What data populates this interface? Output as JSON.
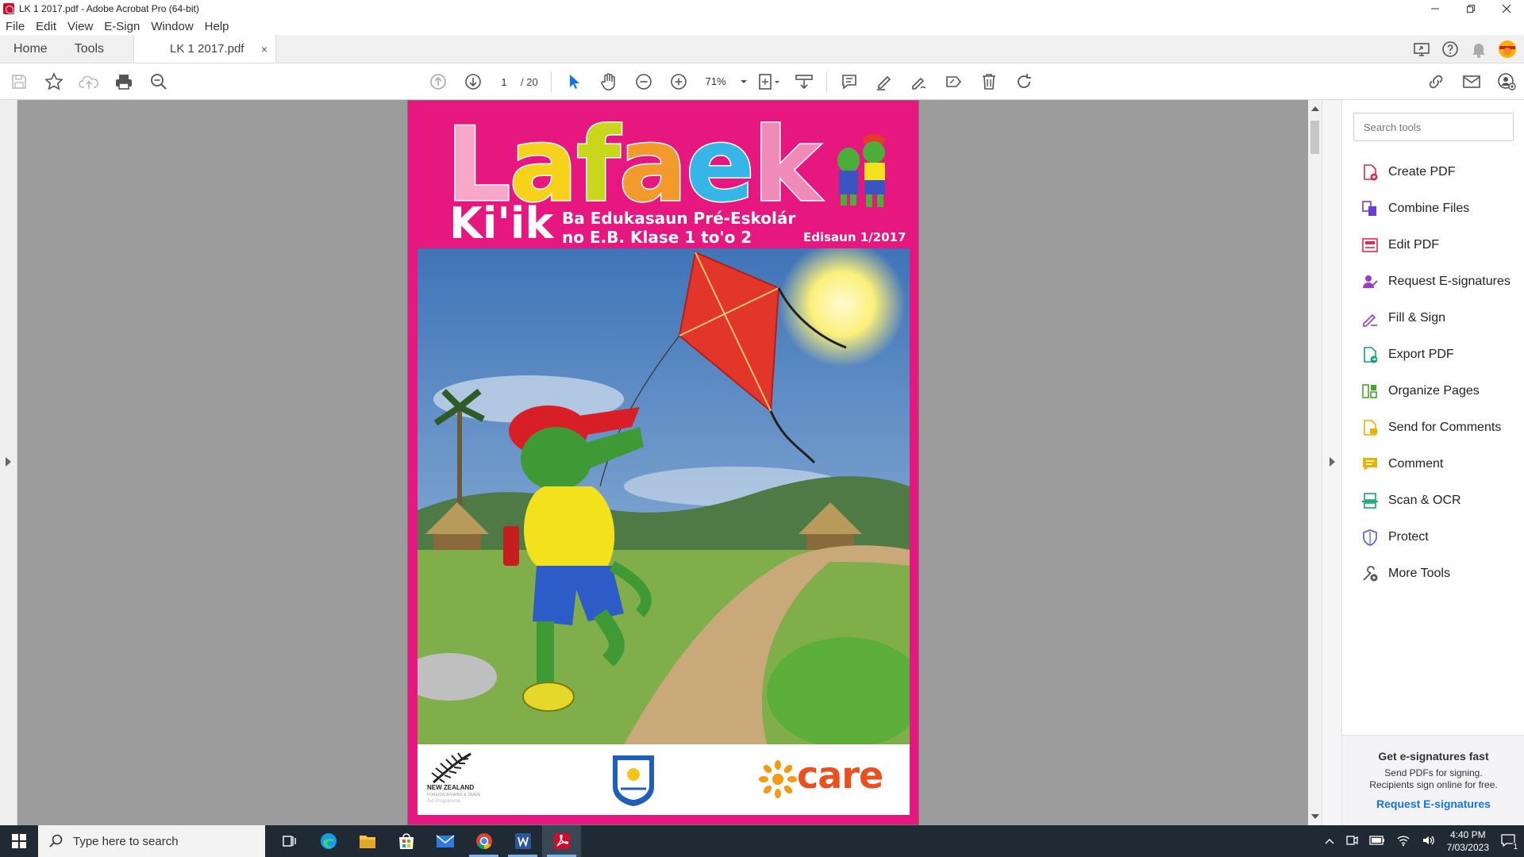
{
  "window": {
    "title": "LK 1 2017.pdf - Adobe Acrobat Pro (64-bit)"
  },
  "menu": [
    "File",
    "Edit",
    "View",
    "E-Sign",
    "Window",
    "Help"
  ],
  "tabs": {
    "home": "Home",
    "tools": "Tools",
    "document": "LK 1 2017.pdf",
    "close_glyph": "×"
  },
  "toolbar": {
    "page_current": "1",
    "page_total": "/ 20",
    "zoom": "71%"
  },
  "document": {
    "title_letters": [
      {
        "ch": "L",
        "color": "#f7a7c8"
      },
      {
        "ch": "a",
        "color": "#f6d21a"
      },
      {
        "ch": "f",
        "color": "#c8d61c"
      },
      {
        "ch": "a",
        "color": "#f39a2c"
      },
      {
        "ch": "e",
        "color": "#35b6e6"
      },
      {
        "ch": "k",
        "color": "#f08ab8"
      }
    ],
    "subtitle": "Ki'ik",
    "tagline_1": "Ba Edukasaun Pré-Eskolár",
    "tagline_2": "no E.B. Klase 1 to'o 2",
    "edition": "Edisaun 1/2017",
    "nz_logo_1": "NEW ZEALAND",
    "nz_logo_2": "FOREIGN AFFAIRS & TRADE",
    "nz_logo_3": "Aid Programme",
    "care_logo": "care"
  },
  "tools_panel": {
    "search_placeholder": "Search tools",
    "items": [
      {
        "label": "Create PDF",
        "icon": "create-pdf-icon",
        "color": "#e0294b"
      },
      {
        "label": "Combine Files",
        "icon": "combine-files-icon",
        "color": "#6b3ccf"
      },
      {
        "label": "Edit PDF",
        "icon": "edit-pdf-icon",
        "color": "#e0294b"
      },
      {
        "label": "Request E-signatures",
        "icon": "request-esign-icon",
        "color": "#9b3cc6"
      },
      {
        "label": "Fill & Sign",
        "icon": "fill-sign-icon",
        "color": "#9b3cc6"
      },
      {
        "label": "Export PDF",
        "icon": "export-pdf-icon",
        "color": "#1aa07a"
      },
      {
        "label": "Organize Pages",
        "icon": "organize-pages-icon",
        "color": "#4aa22e"
      },
      {
        "label": "Send for Comments",
        "icon": "send-comments-icon",
        "color": "#e8b400"
      },
      {
        "label": "Comment",
        "icon": "comment-icon",
        "color": "#e8b400"
      },
      {
        "label": "Scan & OCR",
        "icon": "scan-ocr-icon",
        "color": "#1aa07a"
      },
      {
        "label": "Protect",
        "icon": "protect-icon",
        "color": "#4b5bd6"
      },
      {
        "label": "More Tools",
        "icon": "more-tools-icon",
        "color": "#555555"
      }
    ],
    "promo": {
      "title": "Get e-signatures fast",
      "line1": "Send PDFs for signing.",
      "line2": "Recipients sign online for free.",
      "link": "Request E-signatures"
    }
  },
  "taskbar": {
    "search_placeholder": "Type here to search",
    "time": "4:40 PM",
    "date": "7/03/2023",
    "notification_count": "1"
  }
}
